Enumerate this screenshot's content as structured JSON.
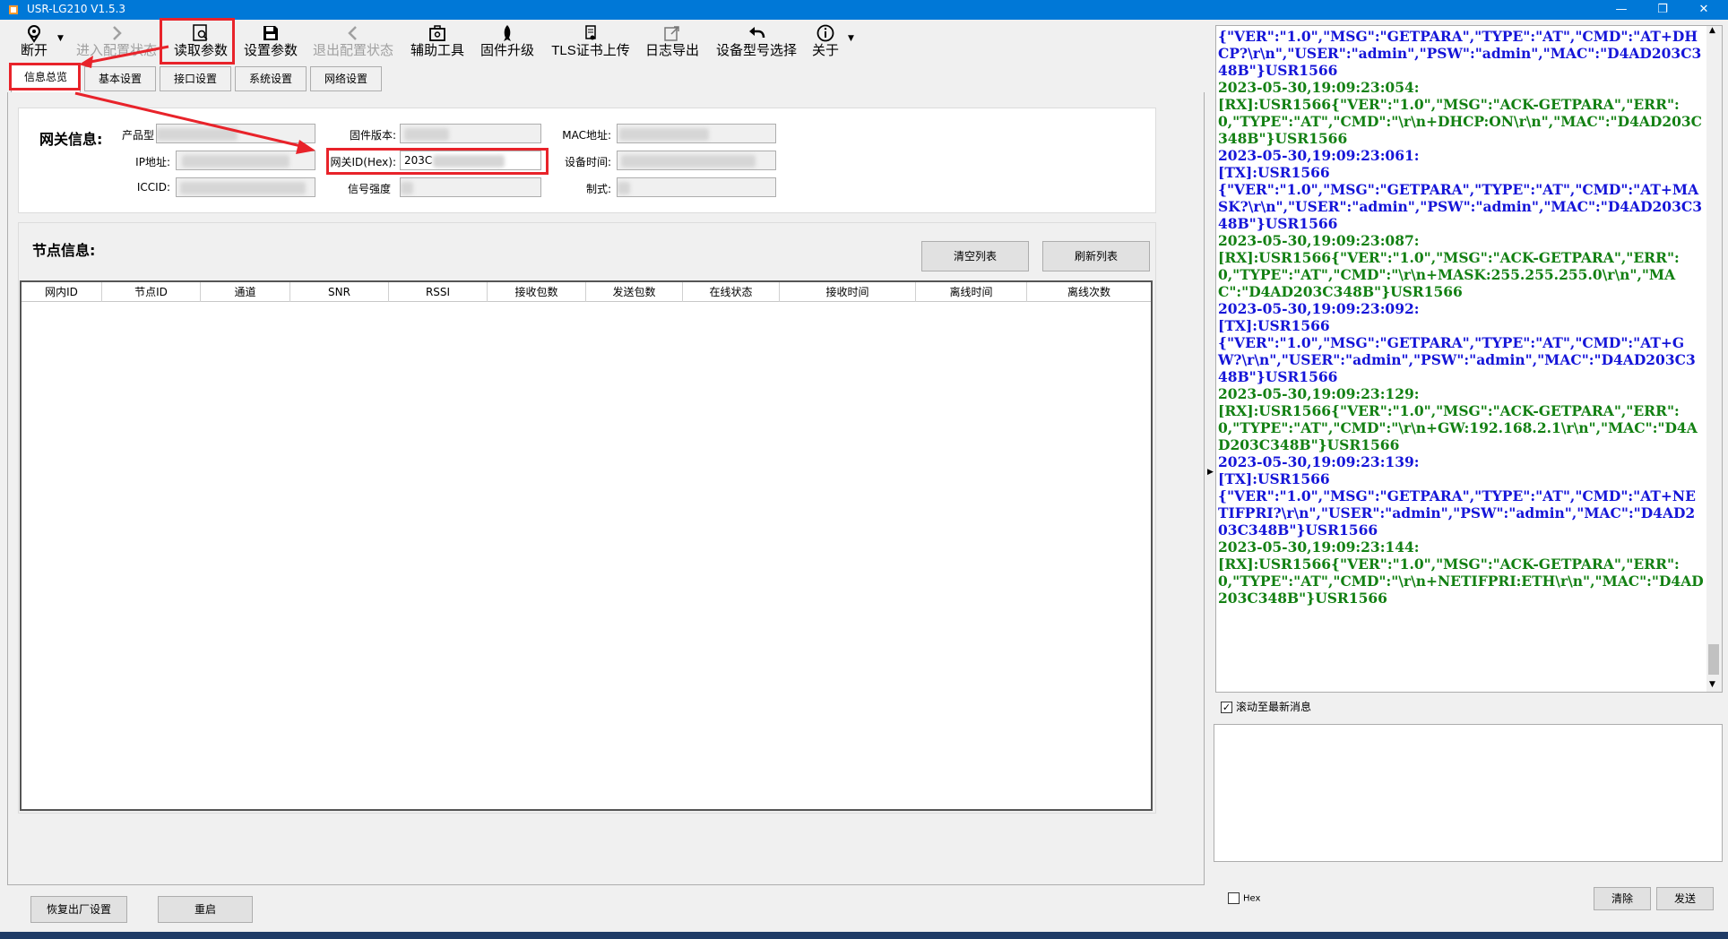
{
  "window": {
    "title": "USR-LG210 V1.5.3",
    "minimize_icon": "minimize-icon",
    "restore_icon": "restore-icon",
    "close_icon": "close-icon"
  },
  "toolbar": {
    "disconnect": "断开",
    "enter_config": "进入配置状态",
    "read_params": "读取参数",
    "set_params": "设置参数",
    "exit_config": "退出配置状态",
    "aux_tools": "辅助工具",
    "firmware_upgrade": "固件升级",
    "tls_upload": "TLS证书上传",
    "log_export": "日志导出",
    "device_model": "设备型号选择",
    "about": "关于"
  },
  "tabs": [
    "信息总览",
    "基本设置",
    "接口设置",
    "系统设置",
    "网络设置"
  ],
  "gateway": {
    "title": "网关信息:",
    "product_label": "产品型",
    "firmware_label": "固件版本:",
    "mac_label": "MAC地址:",
    "ip_label": "IP地址:",
    "gwid_label": "网关ID(Hex):",
    "gwid_value": "203C",
    "devtime_label": "设备时间:",
    "iccid_label": "ICCID:",
    "signal_label": "信号强度",
    "standard_label": "制式:"
  },
  "nodes": {
    "title": "节点信息:",
    "clear_button": "清空列表",
    "refresh_button": "刷新列表",
    "columns": [
      "网内ID",
      "节点ID",
      "通道",
      "SNR",
      "RSSI",
      "接收包数",
      "发送包数",
      "在线状态",
      "接收时间",
      "离线时间",
      "离线次数"
    ]
  },
  "bottom": {
    "factory_reset": "恢复出厂设置",
    "reboot": "重启"
  },
  "log": {
    "entries": [
      {
        "kind": "tx",
        "text": "{\"VER\":\"1.0\",\"MSG\":\"GETPARA\",\"TYPE\":\"AT\",\"CMD\":\"AT+DHCP?\\r\\n\",\"USER\":\"admin\",\"PSW\":\"admin\",\"MAC\":\"D4AD203C348B\"}USR1566"
      },
      {
        "kind": "rx",
        "text": "2023-05-30,19:09:23:054:\n[RX]:USR1566{\"VER\":\"1.0\",\"MSG\":\"ACK-GETPARA\",\"ERR\":0,\"TYPE\":\"AT\",\"CMD\":\"\\r\\n+DHCP:ON\\r\\n\",\"MAC\":\"D4AD203C348B\"}USR1566\n"
      },
      {
        "kind": "tx",
        "text": "2023-05-30,19:09:23:061:\n[TX]:USR1566\n{\"VER\":\"1.0\",\"MSG\":\"GETPARA\",\"TYPE\":\"AT\",\"CMD\":\"AT+MASK?\\r\\n\",\"USER\":\"admin\",\"PSW\":\"admin\",\"MAC\":\"D4AD203C348B\"}USR1566"
      },
      {
        "kind": "rx",
        "text": "2023-05-30,19:09:23:087:\n[RX]:USR1566{\"VER\":\"1.0\",\"MSG\":\"ACK-GETPARA\",\"ERR\":0,\"TYPE\":\"AT\",\"CMD\":\"\\r\\n+MASK:255.255.255.0\\r\\n\",\"MAC\":\"D4AD203C348B\"}USR1566\n"
      },
      {
        "kind": "tx",
        "text": "2023-05-30,19:09:23:092:\n[TX]:USR1566\n{\"VER\":\"1.0\",\"MSG\":\"GETPARA\",\"TYPE\":\"AT\",\"CMD\":\"AT+GW?\\r\\n\",\"USER\":\"admin\",\"PSW\":\"admin\",\"MAC\":\"D4AD203C348B\"}USR1566"
      },
      {
        "kind": "rx",
        "text": "2023-05-30,19:09:23:129:\n[RX]:USR1566{\"VER\":\"1.0\",\"MSG\":\"ACK-GETPARA\",\"ERR\":0,\"TYPE\":\"AT\",\"CMD\":\"\\r\\n+GW:192.168.2.1\\r\\n\",\"MAC\":\"D4AD203C348B\"}USR1566\n"
      },
      {
        "kind": "tx",
        "text": "2023-05-30,19:09:23:139:\n[TX]:USR1566\n{\"VER\":\"1.0\",\"MSG\":\"GETPARA\",\"TYPE\":\"AT\",\"CMD\":\"AT+NETIFPRI?\\r\\n\",\"USER\":\"admin\",\"PSW\":\"admin\",\"MAC\":\"D4AD203C348B\"}USR1566"
      },
      {
        "kind": "rx",
        "text": "2023-05-30,19:09:23:144:\n[RX]:USR1566{\"VER\":\"1.0\",\"MSG\":\"ACK-GETPARA\",\"ERR\":0,\"TYPE\":\"AT\",\"CMD\":\"\\r\\n+NETIFPRI:ETH\\r\\n\",\"MAC\":\"D4AD203C348B\"}USR1566"
      }
    ],
    "autoscroll_label": "滚动至最新消息",
    "autoscroll_checked": true,
    "hex_label": "Hex",
    "hex_checked": false,
    "clear_button": "清除",
    "send_button": "发送"
  },
  "colors": {
    "tx": "#1515d8",
    "rx": "#138013",
    "highlight": "#e8232a",
    "titlebar": "#0078d7"
  }
}
